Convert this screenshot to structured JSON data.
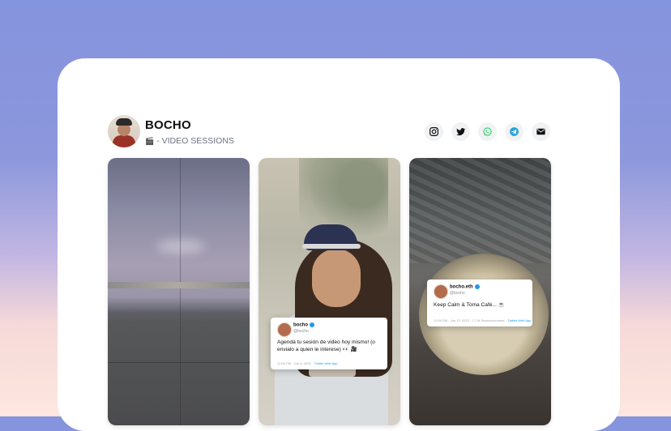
{
  "profile": {
    "name": "BOCHO",
    "subtitle_icon": "🎬",
    "subtitle": "- VIDEO SESSIONS"
  },
  "socials": [
    {
      "icon": "instagram-icon",
      "color": "#111111"
    },
    {
      "icon": "twitter-icon",
      "color": "#111111"
    },
    {
      "icon": "whatsapp-icon",
      "color": "#25d366"
    },
    {
      "icon": "telegram-icon",
      "color": "#2aa3dc"
    },
    {
      "icon": "email-icon",
      "color": "#111111"
    }
  ],
  "videos": [
    {
      "id": "sky"
    },
    {
      "id": "woman",
      "tweet": {
        "name": "bocho",
        "handle": "@bocho",
        "text": "Agendá tu sesión de video hoy mismo! (o envialo a quien le interese) 👀 🎥",
        "time": "12:00 PM · Jun 8, 2023",
        "source": "Twitter Web App"
      }
    },
    {
      "id": "coffee",
      "tweet": {
        "name": "bocho.eth",
        "handle": "@bocho",
        "text": "Keep Calm & Toma Café... ☕",
        "time": "12:00 PM · Jun 12, 2023 · 2.7 M Reproducciones",
        "source": "Twitter Web App"
      }
    }
  ],
  "colors": {
    "background_top": "#8594de",
    "background_bottom": "#fde7df",
    "card": "#ffffff",
    "verified": "#1d9bf0"
  }
}
